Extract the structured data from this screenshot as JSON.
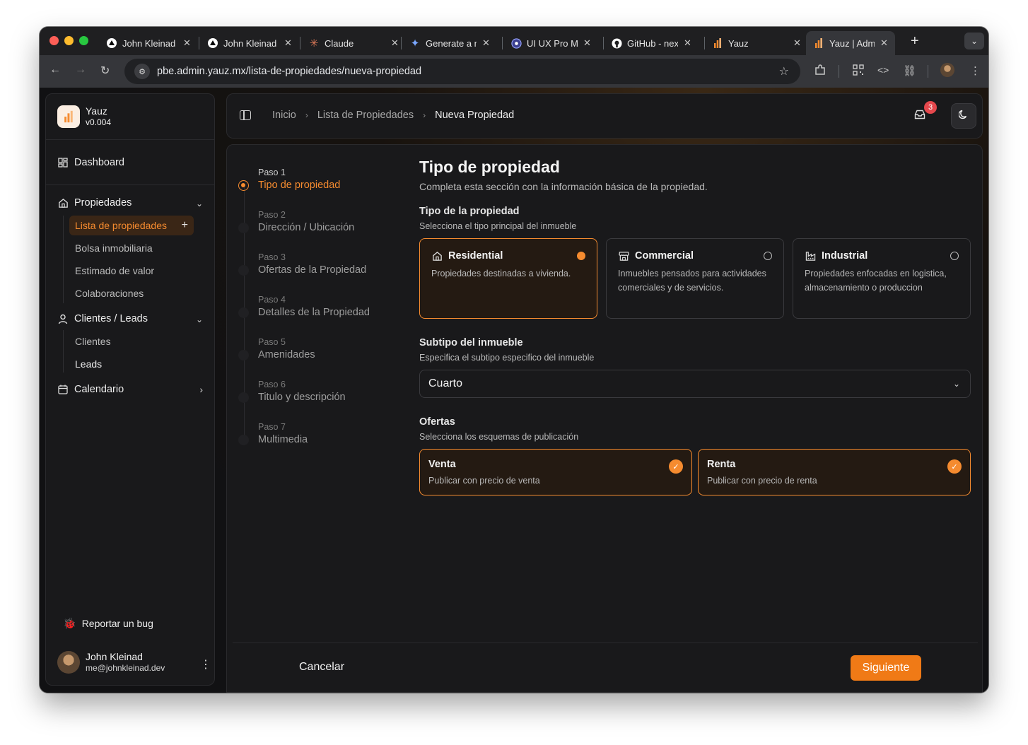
{
  "browser": {
    "tabs": [
      {
        "title": "John Kleinad",
        "icon": "triangle-logo-icon"
      },
      {
        "title": "John Kleinad",
        "icon": "triangle-logo-icon"
      },
      {
        "title": "Claude",
        "icon": "claude-icon"
      },
      {
        "title": "Generate a n",
        "icon": "sparkle-icon"
      },
      {
        "title": "UI UX Pro M",
        "icon": "globe-icon"
      },
      {
        "title": "GitHub - nex",
        "icon": "github-icon"
      },
      {
        "title": "Yauz",
        "icon": "yauz-logo-icon"
      },
      {
        "title": "Yauz | Admin",
        "icon": "yauz-logo-icon",
        "active": true
      }
    ],
    "url": "pbe.admin.yauz.mx/lista-de-propiedades/nueva-propiedad"
  },
  "sidebar": {
    "brand_name": "Yauz",
    "brand_version": "v0.004",
    "dashboard": "Dashboard",
    "propiedades": {
      "label": "Propiedades",
      "items": [
        "Lista de propiedades",
        "Bolsa inmobiliaria",
        "Estimado de valor",
        "Colaboraciones"
      ]
    },
    "clientes": {
      "label": "Clientes / Leads",
      "items": [
        "Clientes",
        "Leads"
      ]
    },
    "calendario": "Calendario",
    "report_bug": "Reportar un bug",
    "user": {
      "name": "John Kleinad",
      "email": "me@johnkleinad.dev"
    }
  },
  "header": {
    "breadcrumbs": [
      "Inicio",
      "Lista de Propiedades",
      "Nueva Propiedad"
    ],
    "notifications": "3"
  },
  "steps": [
    {
      "label": "Paso 1",
      "name": "Tipo de propiedad",
      "active": true
    },
    {
      "label": "Paso 2",
      "name": "Dirección / Ubicación"
    },
    {
      "label": "Paso 3",
      "name": "Ofertas de la Propiedad"
    },
    {
      "label": "Paso 4",
      "name": "Detalles de la Propiedad"
    },
    {
      "label": "Paso 5",
      "name": "Amenidades"
    },
    {
      "label": "Paso 6",
      "name": "Titulo y descripción"
    },
    {
      "label": "Paso 7",
      "name": "Multimedia"
    }
  ],
  "form": {
    "title": "Tipo de propiedad",
    "subtitle": "Completa esta sección con la información básica de la propiedad.",
    "tipo": {
      "title": "Tipo de la propiedad",
      "desc": "Selecciona el tipo principal del inmueble",
      "options": [
        {
          "name": "Residential",
          "desc": "Propiedades destinadas a vivienda.",
          "selected": true
        },
        {
          "name": "Commercial",
          "desc": "Inmuebles pensados para actividades comerciales y de servicios.",
          "selected": false
        },
        {
          "name": "Industrial",
          "desc": "Propiedades enfocadas en logistica, almacenamiento o produccion",
          "selected": false
        }
      ]
    },
    "subtipo": {
      "title": "Subtipo del inmueble",
      "desc": "Especifica el subtipo especifico del inmueble",
      "value": "Cuarto"
    },
    "ofertas": {
      "title": "Ofertas",
      "desc": "Selecciona los esquemas de publicación",
      "options": [
        {
          "name": "Venta",
          "desc": "Publicar con precio de venta",
          "checked": true
        },
        {
          "name": "Renta",
          "desc": "Publicar con precio de renta",
          "checked": true
        }
      ]
    },
    "cancel": "Cancelar",
    "next": "Siguiente"
  },
  "colors": {
    "accent": "#f58b2f",
    "button": "#f07a16",
    "badge": "#e5484d"
  }
}
